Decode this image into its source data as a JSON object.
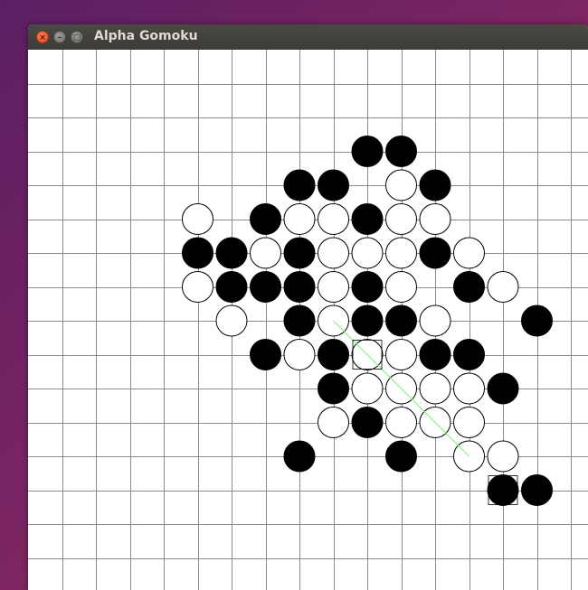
{
  "window": {
    "title": "Alpha Gomoku",
    "controls": {
      "close": "×",
      "minimize": "–",
      "maximize": "□"
    }
  },
  "board": {
    "colors": {
      "background": "#ffffff",
      "grid": "#8a8a8a",
      "black_stone": "#000000",
      "white_stone": "#ffffff",
      "stone_outline": "#000000",
      "win_line": "#90ee90",
      "last_move_marker": "#000000"
    },
    "stones": [
      {
        "row": 3,
        "col": 10,
        "color": "black"
      },
      {
        "row": 3,
        "col": 11,
        "color": "black"
      },
      {
        "row": 4,
        "col": 8,
        "color": "black"
      },
      {
        "row": 4,
        "col": 9,
        "color": "black"
      },
      {
        "row": 4,
        "col": 11,
        "color": "white"
      },
      {
        "row": 4,
        "col": 12,
        "color": "black"
      },
      {
        "row": 5,
        "col": 5,
        "color": "white"
      },
      {
        "row": 5,
        "col": 7,
        "color": "black"
      },
      {
        "row": 5,
        "col": 8,
        "color": "white"
      },
      {
        "row": 5,
        "col": 9,
        "color": "white"
      },
      {
        "row": 5,
        "col": 10,
        "color": "black"
      },
      {
        "row": 5,
        "col": 11,
        "color": "white"
      },
      {
        "row": 5,
        "col": 12,
        "color": "white"
      },
      {
        "row": 6,
        "col": 5,
        "color": "black"
      },
      {
        "row": 6,
        "col": 6,
        "color": "black"
      },
      {
        "row": 6,
        "col": 7,
        "color": "white"
      },
      {
        "row": 6,
        "col": 8,
        "color": "black"
      },
      {
        "row": 6,
        "col": 9,
        "color": "white"
      },
      {
        "row": 6,
        "col": 10,
        "color": "white"
      },
      {
        "row": 6,
        "col": 11,
        "color": "white"
      },
      {
        "row": 6,
        "col": 12,
        "color": "black"
      },
      {
        "row": 6,
        "col": 13,
        "color": "white"
      },
      {
        "row": 7,
        "col": 5,
        "color": "white"
      },
      {
        "row": 7,
        "col": 6,
        "color": "black"
      },
      {
        "row": 7,
        "col": 7,
        "color": "black"
      },
      {
        "row": 7,
        "col": 8,
        "color": "black"
      },
      {
        "row": 7,
        "col": 9,
        "color": "white"
      },
      {
        "row": 7,
        "col": 10,
        "color": "black"
      },
      {
        "row": 7,
        "col": 11,
        "color": "white"
      },
      {
        "row": 7,
        "col": 13,
        "color": "black"
      },
      {
        "row": 7,
        "col": 14,
        "color": "white"
      },
      {
        "row": 8,
        "col": 6,
        "color": "white"
      },
      {
        "row": 8,
        "col": 8,
        "color": "black"
      },
      {
        "row": 8,
        "col": 9,
        "color": "white"
      },
      {
        "row": 8,
        "col": 10,
        "color": "black"
      },
      {
        "row": 8,
        "col": 11,
        "color": "black"
      },
      {
        "row": 8,
        "col": 12,
        "color": "white"
      },
      {
        "row": 8,
        "col": 15,
        "color": "black"
      },
      {
        "row": 9,
        "col": 7,
        "color": "black"
      },
      {
        "row": 9,
        "col": 8,
        "color": "white"
      },
      {
        "row": 9,
        "col": 9,
        "color": "black"
      },
      {
        "row": 9,
        "col": 10,
        "color": "white"
      },
      {
        "row": 9,
        "col": 11,
        "color": "white"
      },
      {
        "row": 9,
        "col": 12,
        "color": "black"
      },
      {
        "row": 9,
        "col": 13,
        "color": "black"
      },
      {
        "row": 10,
        "col": 9,
        "color": "black"
      },
      {
        "row": 10,
        "col": 10,
        "color": "white"
      },
      {
        "row": 10,
        "col": 11,
        "color": "white"
      },
      {
        "row": 10,
        "col": 12,
        "color": "white"
      },
      {
        "row": 10,
        "col": 13,
        "color": "white"
      },
      {
        "row": 10,
        "col": 14,
        "color": "black"
      },
      {
        "row": 11,
        "col": 9,
        "color": "white"
      },
      {
        "row": 11,
        "col": 10,
        "color": "black"
      },
      {
        "row": 11,
        "col": 11,
        "color": "white"
      },
      {
        "row": 11,
        "col": 12,
        "color": "white"
      },
      {
        "row": 11,
        "col": 13,
        "color": "white"
      },
      {
        "row": 12,
        "col": 8,
        "color": "black"
      },
      {
        "row": 12,
        "col": 11,
        "color": "black"
      },
      {
        "row": 12,
        "col": 13,
        "color": "white"
      },
      {
        "row": 12,
        "col": 14,
        "color": "white"
      },
      {
        "row": 13,
        "col": 14,
        "color": "black"
      },
      {
        "row": 13,
        "col": 15,
        "color": "black"
      }
    ],
    "markers": [
      {
        "row": 9,
        "col": 10
      },
      {
        "row": 13,
        "col": 14
      }
    ],
    "win_line": {
      "from": {
        "row": 8,
        "col": 9
      },
      "to": {
        "row": 12,
        "col": 13
      }
    }
  }
}
